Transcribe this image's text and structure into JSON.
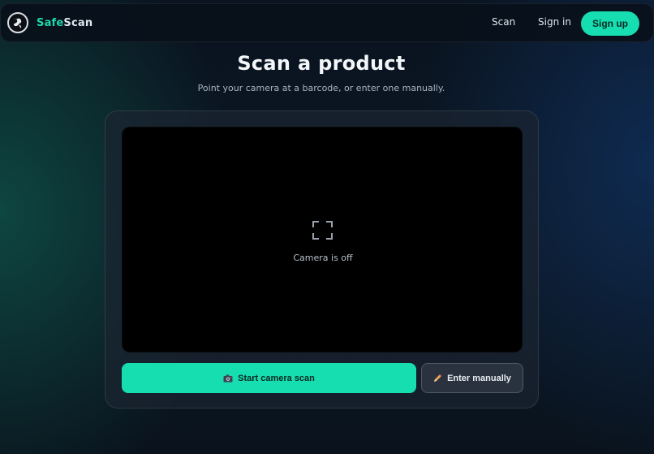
{
  "navbar": {
    "brand_part1": "Safe",
    "brand_part2": "Scan",
    "links": {
      "scan": "Scan",
      "sign_in": "Sign in"
    },
    "sign_up": "Sign up"
  },
  "main": {
    "title": "Scan a product",
    "subtitle": "Point your camera at a barcode, or enter one manually."
  },
  "scanner": {
    "camera_status": "Camera is off",
    "start_button": "Start camera scan",
    "manual_button": "Enter manually"
  },
  "icons": {
    "logo": "globe-logo-icon",
    "focus": "scan-frame-icon",
    "start": "camera-icon",
    "manual": "pencil-icon"
  },
  "colors": {
    "accent": "#16deb1",
    "brand_accent": "#1fd8ad",
    "camera_bg": "#000000"
  }
}
